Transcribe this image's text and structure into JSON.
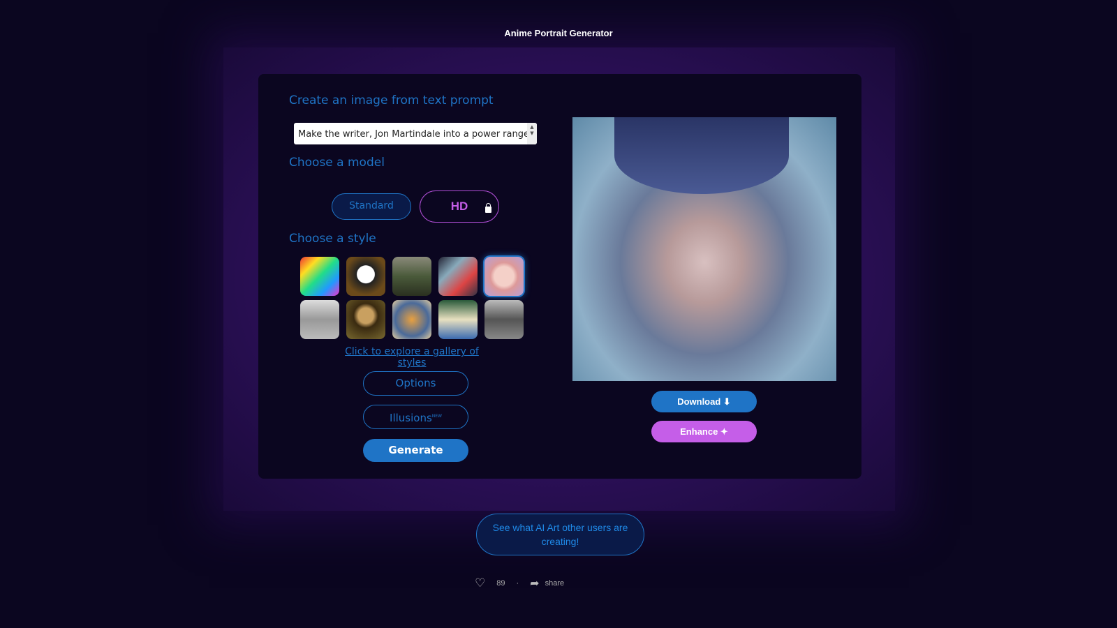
{
  "page": {
    "title": "Anime Portrait Generator"
  },
  "form": {
    "prompt_heading": "Create an image from text prompt",
    "prompt_value": "Make the writer, Jon Martindale into a power ranger",
    "model_heading": "Choose a model",
    "models": [
      {
        "label": "Standard",
        "selected": true
      },
      {
        "label": "HD",
        "locked": true
      }
    ],
    "style_heading": "Choose a style",
    "styles": [
      "psychedelic",
      "panda",
      "forest",
      "mech",
      "anime",
      "sketch",
      "mona-lisa",
      "flowers",
      "dancers",
      "city"
    ],
    "selected_style": "anime",
    "gallery_link": "Click to explore a gallery of styles",
    "options_label": "Options",
    "illusions_label": "Illusions",
    "illusions_badge": "NEW",
    "generate_label": "Generate"
  },
  "result": {
    "download_label": "Download ⬇",
    "enhance_label": "Enhance ✦"
  },
  "footer": {
    "see_label": "See what AI Art other users are creating!",
    "likes": "89",
    "share_label": "share"
  },
  "colors": {
    "accent": "#1f74c6",
    "hd": "#c55ee8",
    "background": "#0b0620"
  }
}
